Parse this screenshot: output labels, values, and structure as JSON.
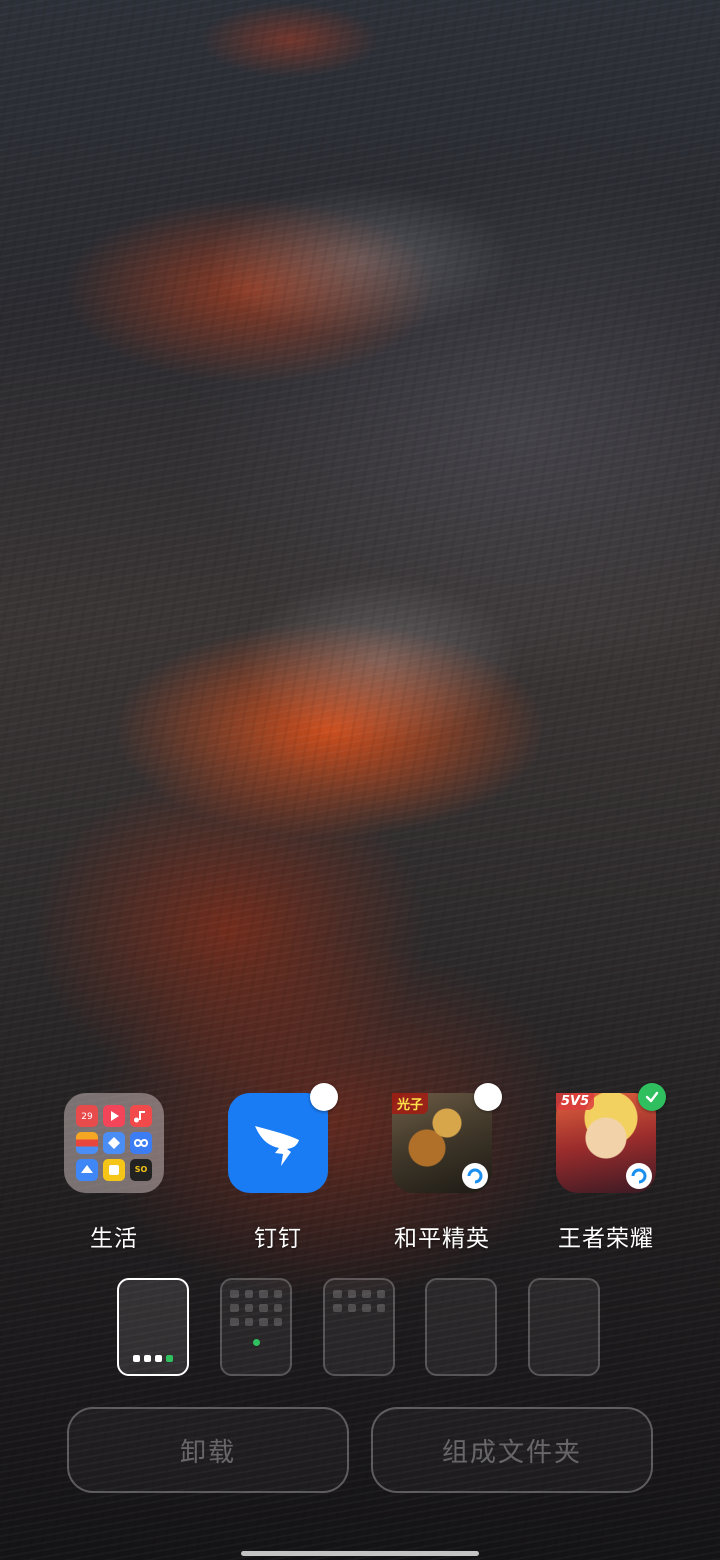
{
  "apps": [
    {
      "label": "生活",
      "type": "folder",
      "selected": null
    },
    {
      "label": "钉钉",
      "type": "app",
      "selected": false
    },
    {
      "label": "和平精英",
      "type": "app",
      "selected": false,
      "badge_text": "光子"
    },
    {
      "label": "王者荣耀",
      "type": "app",
      "selected": true,
      "badge_text": "5V5"
    }
  ],
  "folder_icons": [
    {
      "name": "calendar-icon",
      "color": "#e84b4b",
      "text": "29"
    },
    {
      "name": "video-icon",
      "color": "#f2455a"
    },
    {
      "name": "music-icon",
      "color": "#f24a4a"
    },
    {
      "name": "wallet-icon",
      "color": "#f5a623"
    },
    {
      "name": "theme-icon",
      "color": "#4a8df5"
    },
    {
      "name": "loop-icon",
      "color": "#3d7df3"
    },
    {
      "name": "cloud-icon",
      "color": "#3f86f6"
    },
    {
      "name": "notes-icon",
      "color": "#f5c518"
    },
    {
      "name": "so-app-icon",
      "color": "#222222",
      "text": "SO"
    }
  ],
  "pages": {
    "count": 5,
    "active_index": 0
  },
  "actions": {
    "uninstall_label": "卸载",
    "make_folder_label": "组成文件夹"
  },
  "colors": {
    "dingtalk_blue": "#1a7cf5",
    "check_green": "#2fbf5f"
  }
}
